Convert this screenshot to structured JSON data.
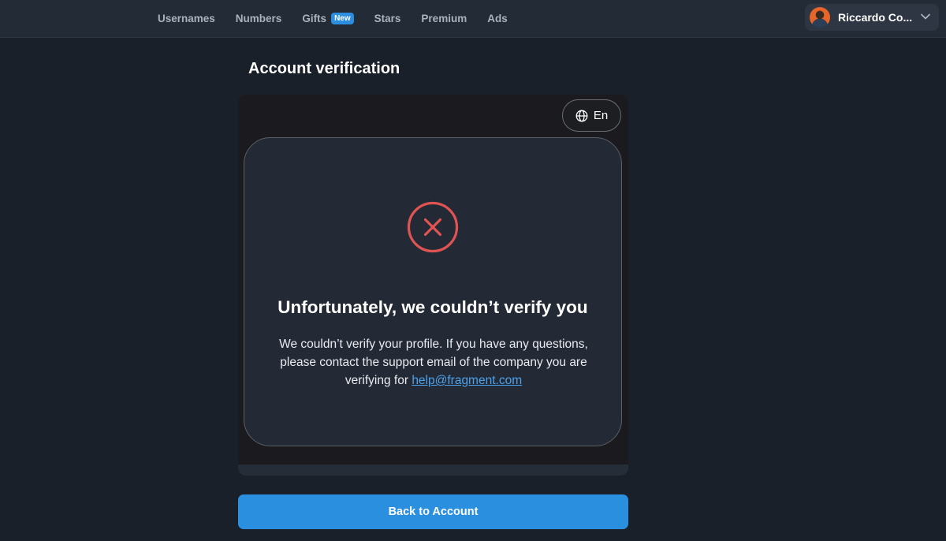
{
  "nav": {
    "items": [
      {
        "label": "Usernames"
      },
      {
        "label": "Numbers"
      },
      {
        "label": "Gifts",
        "badge": "New"
      },
      {
        "label": "Stars"
      },
      {
        "label": "Premium"
      },
      {
        "label": "Ads"
      }
    ]
  },
  "user": {
    "name": "Riccardo Co...",
    "avatar_icon": "user-avatar",
    "menu_icon": "chevron-down-icon"
  },
  "page": {
    "title": "Account verification"
  },
  "verification": {
    "language_label": "En",
    "language_icon": "globe-icon",
    "status_icon": "error-x-circle-icon",
    "title": "Unfortunately, we couldn’t verify you",
    "message": "We couldn’t verify your profile. If you have any questions, please contact the support email of the company you are verifying for",
    "email": "help@fragment.com"
  },
  "actions": {
    "back_label": "Back to Account"
  },
  "colors": {
    "background": "#1a2029",
    "topbar": "#232b37",
    "accent": "#2b8fe0",
    "error": "#e05353",
    "link": "#4da2ec"
  }
}
